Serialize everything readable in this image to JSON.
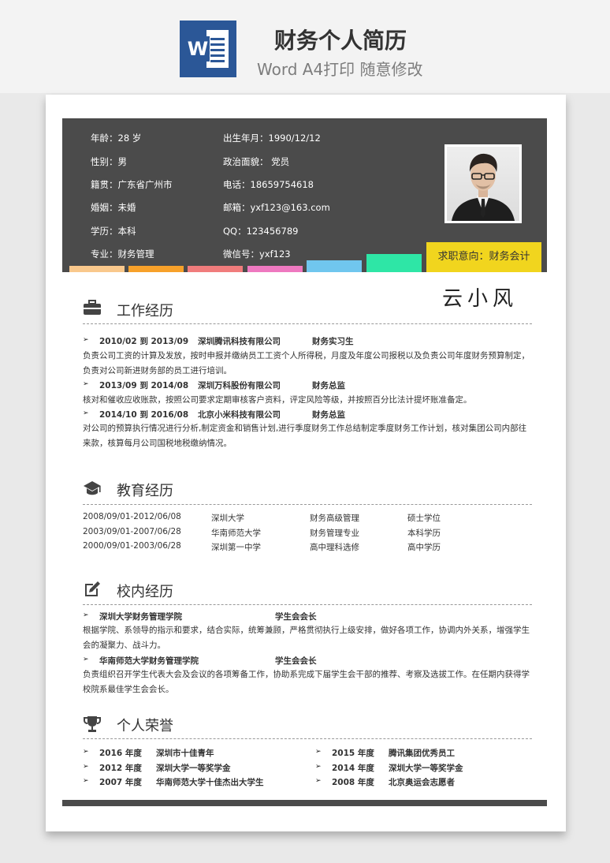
{
  "banner": {
    "title": "财务个人简历",
    "subtitle": "Word A4打印 随意修改",
    "word_letter": "W"
  },
  "header": {
    "left": [
      "年龄：28 岁",
      "性别：男",
      "籍贯：广东省广州市",
      "婚姻：未婚",
      "学历：本科",
      "专业：财务管理"
    ],
    "right": [
      "出生年月：1990/12/12",
      "政治面貌： 党员",
      "电话：18659754618",
      "邮箱：yxf123@163.com",
      "QQ：123456789",
      "微信号：yxf123"
    ],
    "intent": "求职意向：财务会计",
    "bar_colors": [
      "#f9c88c",
      "#f7a12a",
      "#f07c7c",
      "#ee79c0",
      "#70c6ee",
      "#2ee6a6"
    ]
  },
  "name": "云小风",
  "work": {
    "title": "工作经历",
    "items": [
      {
        "period": "2010/02 到 2013/09",
        "company": "深圳腾讯科技有限公司",
        "role": "财务实习生",
        "desc": "负责公司工资的计算及发放，按时申报并缴纳员工工资个人所得税，月度及年度公司报税以及负责公司年度财务预算制定，负责对公司新进财务部的员工进行培训。"
      },
      {
        "period": "2013/09 到 2014/08",
        "company": "深圳万科股份有限公司",
        "role": "财务总监",
        "desc": "核对和催收应收账款，按照公司要求定期审核客户资料，评定风险等级，并按照百分比法计提坏账准备定。"
      },
      {
        "period": "2014/10 到 2016/08",
        "company": "北京小米科技有限公司",
        "role": "财务总监",
        "desc": "对公司的预算执行情况进行分析,制定资金和销售计划,进行季度财务工作总结制定季度财务工作计划，核对集团公司内部往来款，核算每月公司国税地税缴纳情况。"
      }
    ]
  },
  "education": {
    "title": "教育经历",
    "rows": [
      [
        "2008/09/01-2012/06/08",
        "深圳大学",
        "财务高级管理",
        "硕士学位"
      ],
      [
        "2003/09/01-2007/06/28",
        "华南师范大学",
        "财务管理专业",
        "本科学历"
      ],
      [
        "2000/09/01-2003/06/28",
        "深圳第一中学",
        "高中理科选修",
        "高中学历"
      ]
    ]
  },
  "campus": {
    "title": "校内经历",
    "items": [
      {
        "org": "深圳大学财务管理学院",
        "role": "学生会会长",
        "desc": "根据学院、系领导的指示和要求，结合实际，统筹兼顾，严格贯彻执行上级安排，做好各项工作，协调内外关系，增强学生会的凝聚力、战斗力。"
      },
      {
        "org": "华南师范大学财务管理学院",
        "role": "学生会会长",
        "desc": "负责组织召开学生代表大会及会议的各项筹备工作，协助系完成下届学生会干部的推荐、考察及选拔工作。在任期内获得学校院系最佳学生会会长。"
      }
    ]
  },
  "honors": {
    "title": "个人荣誉",
    "left": [
      [
        "2016 年度",
        "深圳市十佳青年"
      ],
      [
        "2012 年度",
        "深圳大学一等奖学金"
      ],
      [
        "2007 年度",
        "华南师范大学十佳杰出大学生"
      ]
    ],
    "right": [
      [
        "2015 年度",
        "腾讯集团优秀员工"
      ],
      [
        "2014 年度",
        "深圳大学一等奖学金"
      ],
      [
        "2008 年度",
        "北京奥运会志愿者"
      ]
    ]
  },
  "bullet": "➢"
}
